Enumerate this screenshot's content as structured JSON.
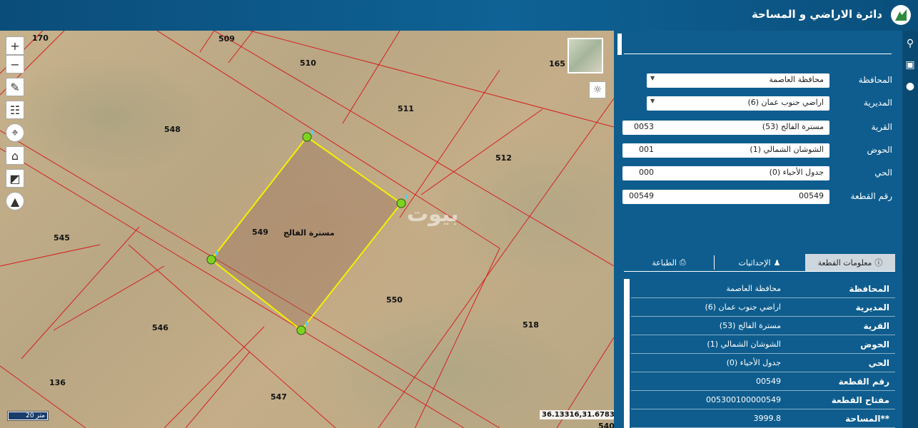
{
  "header": {
    "title": "دائرة الاراضي و المساحة"
  },
  "map": {
    "parcel_numbers": [
      "170",
      "509",
      "510",
      "165",
      "511",
      "548",
      "512",
      "549",
      "545",
      "550",
      "546",
      "518",
      "136",
      "547",
      "540"
    ],
    "selected_parcel_name": "مسترة الفالج",
    "scale_label": "20 متر",
    "coordinates": "36.13316,31.67833",
    "watermark": "بيوت"
  },
  "tools": [
    "zoom-in-icon",
    "zoom-out-icon",
    "pencil-icon",
    "ruler-icon",
    "crosshair-icon",
    "home-icon",
    "chart-icon",
    "compass-icon"
  ],
  "form": {
    "governorate": {
      "label": "المحافظة",
      "value": "محافظة العاصمة"
    },
    "directorate": {
      "label": "المديرية",
      "value": "اراضي جنوب عمان (6)"
    },
    "village": {
      "label": "القرية",
      "value": "مسترة الفالج (53)",
      "code": "0053"
    },
    "basin": {
      "label": "الحوض",
      "value": "الشوشان الشمالي (1)",
      "code": "001"
    },
    "district": {
      "label": "الحي",
      "value": "جدول الأحياء (0)",
      "code": "000"
    },
    "parcel": {
      "label": "رقم القطعة",
      "value": "00549",
      "code": "00549"
    }
  },
  "tabs": {
    "info": "معلومات القطعة",
    "coords": "الإحداثيات",
    "print": "الطباعة"
  },
  "info": [
    {
      "key": "المحافظة",
      "value": "محافظة العاصمة"
    },
    {
      "key": "المديرية",
      "value": "اراضي جنوب عمان (6)"
    },
    {
      "key": "القرية",
      "value": "مسترة الفالج (53)"
    },
    {
      "key": "الحوض",
      "value": "الشوشان الشمالي (1)"
    },
    {
      "key": "الحي",
      "value": "جدول الأحياء (0)"
    },
    {
      "key": "رقم القطعة",
      "value": "00549"
    },
    {
      "key": "مفتاح القطعة",
      "value": "005300100000549"
    },
    {
      "key": "**المساحة",
      "value": "3999.8"
    }
  ]
}
